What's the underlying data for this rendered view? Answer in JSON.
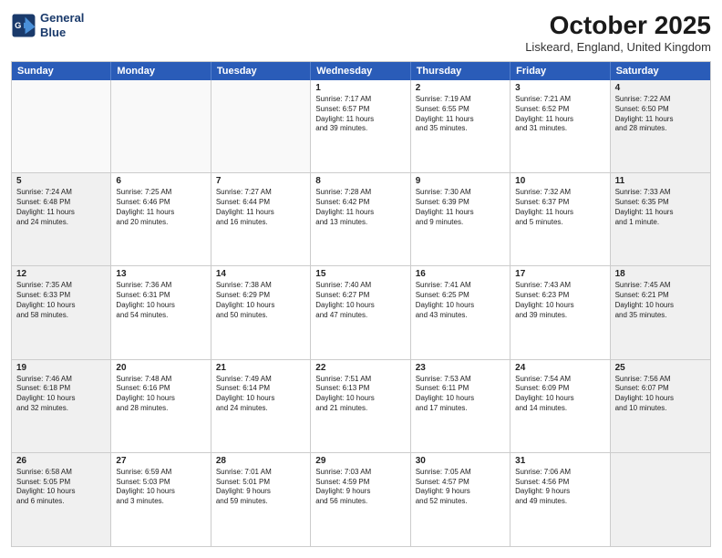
{
  "header": {
    "logo_line1": "General",
    "logo_line2": "Blue",
    "month": "October 2025",
    "location": "Liskeard, England, United Kingdom"
  },
  "weekdays": [
    "Sunday",
    "Monday",
    "Tuesday",
    "Wednesday",
    "Thursday",
    "Friday",
    "Saturday"
  ],
  "rows": [
    [
      {
        "day": "",
        "text": "",
        "empty": true
      },
      {
        "day": "",
        "text": "",
        "empty": true
      },
      {
        "day": "",
        "text": "",
        "empty": true
      },
      {
        "day": "1",
        "text": "Sunrise: 7:17 AM\nSunset: 6:57 PM\nDaylight: 11 hours\nand 39 minutes.",
        "empty": false
      },
      {
        "day": "2",
        "text": "Sunrise: 7:19 AM\nSunset: 6:55 PM\nDaylight: 11 hours\nand 35 minutes.",
        "empty": false
      },
      {
        "day": "3",
        "text": "Sunrise: 7:21 AM\nSunset: 6:52 PM\nDaylight: 11 hours\nand 31 minutes.",
        "empty": false
      },
      {
        "day": "4",
        "text": "Sunrise: 7:22 AM\nSunset: 6:50 PM\nDaylight: 11 hours\nand 28 minutes.",
        "empty": false,
        "shaded": true
      }
    ],
    [
      {
        "day": "5",
        "text": "Sunrise: 7:24 AM\nSunset: 6:48 PM\nDaylight: 11 hours\nand 24 minutes.",
        "empty": false,
        "shaded": true
      },
      {
        "day": "6",
        "text": "Sunrise: 7:25 AM\nSunset: 6:46 PM\nDaylight: 11 hours\nand 20 minutes.",
        "empty": false
      },
      {
        "day": "7",
        "text": "Sunrise: 7:27 AM\nSunset: 6:44 PM\nDaylight: 11 hours\nand 16 minutes.",
        "empty": false
      },
      {
        "day": "8",
        "text": "Sunrise: 7:28 AM\nSunset: 6:42 PM\nDaylight: 11 hours\nand 13 minutes.",
        "empty": false
      },
      {
        "day": "9",
        "text": "Sunrise: 7:30 AM\nSunset: 6:39 PM\nDaylight: 11 hours\nand 9 minutes.",
        "empty": false
      },
      {
        "day": "10",
        "text": "Sunrise: 7:32 AM\nSunset: 6:37 PM\nDaylight: 11 hours\nand 5 minutes.",
        "empty": false
      },
      {
        "day": "11",
        "text": "Sunrise: 7:33 AM\nSunset: 6:35 PM\nDaylight: 11 hours\nand 1 minute.",
        "empty": false,
        "shaded": true
      }
    ],
    [
      {
        "day": "12",
        "text": "Sunrise: 7:35 AM\nSunset: 6:33 PM\nDaylight: 10 hours\nand 58 minutes.",
        "empty": false,
        "shaded": true
      },
      {
        "day": "13",
        "text": "Sunrise: 7:36 AM\nSunset: 6:31 PM\nDaylight: 10 hours\nand 54 minutes.",
        "empty": false
      },
      {
        "day": "14",
        "text": "Sunrise: 7:38 AM\nSunset: 6:29 PM\nDaylight: 10 hours\nand 50 minutes.",
        "empty": false
      },
      {
        "day": "15",
        "text": "Sunrise: 7:40 AM\nSunset: 6:27 PM\nDaylight: 10 hours\nand 47 minutes.",
        "empty": false
      },
      {
        "day": "16",
        "text": "Sunrise: 7:41 AM\nSunset: 6:25 PM\nDaylight: 10 hours\nand 43 minutes.",
        "empty": false
      },
      {
        "day": "17",
        "text": "Sunrise: 7:43 AM\nSunset: 6:23 PM\nDaylight: 10 hours\nand 39 minutes.",
        "empty": false
      },
      {
        "day": "18",
        "text": "Sunrise: 7:45 AM\nSunset: 6:21 PM\nDaylight: 10 hours\nand 35 minutes.",
        "empty": false,
        "shaded": true
      }
    ],
    [
      {
        "day": "19",
        "text": "Sunrise: 7:46 AM\nSunset: 6:18 PM\nDaylight: 10 hours\nand 32 minutes.",
        "empty": false,
        "shaded": true
      },
      {
        "day": "20",
        "text": "Sunrise: 7:48 AM\nSunset: 6:16 PM\nDaylight: 10 hours\nand 28 minutes.",
        "empty": false
      },
      {
        "day": "21",
        "text": "Sunrise: 7:49 AM\nSunset: 6:14 PM\nDaylight: 10 hours\nand 24 minutes.",
        "empty": false
      },
      {
        "day": "22",
        "text": "Sunrise: 7:51 AM\nSunset: 6:13 PM\nDaylight: 10 hours\nand 21 minutes.",
        "empty": false
      },
      {
        "day": "23",
        "text": "Sunrise: 7:53 AM\nSunset: 6:11 PM\nDaylight: 10 hours\nand 17 minutes.",
        "empty": false
      },
      {
        "day": "24",
        "text": "Sunrise: 7:54 AM\nSunset: 6:09 PM\nDaylight: 10 hours\nand 14 minutes.",
        "empty": false
      },
      {
        "day": "25",
        "text": "Sunrise: 7:56 AM\nSunset: 6:07 PM\nDaylight: 10 hours\nand 10 minutes.",
        "empty": false,
        "shaded": true
      }
    ],
    [
      {
        "day": "26",
        "text": "Sunrise: 6:58 AM\nSunset: 5:05 PM\nDaylight: 10 hours\nand 6 minutes.",
        "empty": false,
        "shaded": true
      },
      {
        "day": "27",
        "text": "Sunrise: 6:59 AM\nSunset: 5:03 PM\nDaylight: 10 hours\nand 3 minutes.",
        "empty": false
      },
      {
        "day": "28",
        "text": "Sunrise: 7:01 AM\nSunset: 5:01 PM\nDaylight: 9 hours\nand 59 minutes.",
        "empty": false
      },
      {
        "day": "29",
        "text": "Sunrise: 7:03 AM\nSunset: 4:59 PM\nDaylight: 9 hours\nand 56 minutes.",
        "empty": false
      },
      {
        "day": "30",
        "text": "Sunrise: 7:05 AM\nSunset: 4:57 PM\nDaylight: 9 hours\nand 52 minutes.",
        "empty": false
      },
      {
        "day": "31",
        "text": "Sunrise: 7:06 AM\nSunset: 4:56 PM\nDaylight: 9 hours\nand 49 minutes.",
        "empty": false
      },
      {
        "day": "",
        "text": "",
        "empty": true,
        "shaded": true
      }
    ]
  ]
}
